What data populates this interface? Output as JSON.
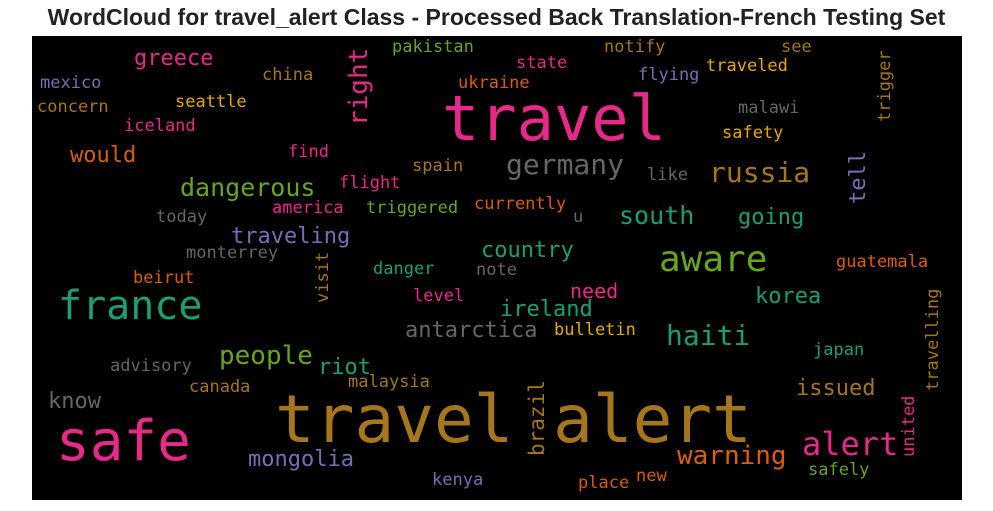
{
  "title": "WordCloud for travel_alert Class - Processed Back Translation-French Testing Set",
  "colors": {
    "pink": "#e7298a",
    "green": "#66a61e",
    "teal": "#1b9e77",
    "orange": "#d95f02",
    "purple": "#7570b3",
    "gold": "#e6ab02",
    "brown": "#a6761d",
    "gray": "#666666"
  },
  "words": [
    {
      "text": "travel alert",
      "color": "brown"
    },
    {
      "text": "travel",
      "color": "pink"
    },
    {
      "text": "safe",
      "color": "pink"
    },
    {
      "text": "france",
      "color": "teal"
    },
    {
      "text": "aware",
      "color": "green"
    },
    {
      "text": "alert",
      "color": "pink"
    },
    {
      "text": "germany",
      "color": "gray"
    },
    {
      "text": "russia",
      "color": "brown"
    },
    {
      "text": "haiti",
      "color": "teal"
    },
    {
      "text": "dangerous",
      "color": "green"
    },
    {
      "text": "warning",
      "color": "orange"
    },
    {
      "text": "people",
      "color": "green"
    },
    {
      "text": "south",
      "color": "teal"
    },
    {
      "text": "right",
      "color": "pink"
    },
    {
      "text": "mongolia",
      "color": "purple"
    },
    {
      "text": "antarctica",
      "color": "gray"
    },
    {
      "text": "traveling",
      "color": "purple"
    },
    {
      "text": "going",
      "color": "teal"
    },
    {
      "text": "ireland",
      "color": "teal"
    },
    {
      "text": "country",
      "color": "teal"
    },
    {
      "text": "korea",
      "color": "teal"
    },
    {
      "text": "issued",
      "color": "brown"
    },
    {
      "text": "greece",
      "color": "pink"
    },
    {
      "text": "would",
      "color": "orange"
    },
    {
      "text": "need",
      "color": "pink"
    },
    {
      "text": "brazil",
      "color": "brown"
    },
    {
      "text": "riot",
      "color": "teal"
    },
    {
      "text": "tell",
      "color": "purple"
    },
    {
      "text": "know",
      "color": "gray"
    },
    {
      "text": "flight",
      "color": "pink"
    },
    {
      "text": "mexico",
      "color": "purple"
    },
    {
      "text": "concern",
      "color": "brown"
    },
    {
      "text": "china",
      "color": "brown"
    },
    {
      "text": "pakistan",
      "color": "green"
    },
    {
      "text": "state",
      "color": "pink"
    },
    {
      "text": "ukraine",
      "color": "orange"
    },
    {
      "text": "notify",
      "color": "brown"
    },
    {
      "text": "flying",
      "color": "purple"
    },
    {
      "text": "see",
      "color": "brown"
    },
    {
      "text": "traveled",
      "color": "gold"
    },
    {
      "text": "trigger",
      "color": "brown"
    },
    {
      "text": "seattle",
      "color": "gold"
    },
    {
      "text": "iceland",
      "color": "pink"
    },
    {
      "text": "malawi",
      "color": "gray"
    },
    {
      "text": "safety",
      "color": "gold"
    },
    {
      "text": "find",
      "color": "pink"
    },
    {
      "text": "spain",
      "color": "brown"
    },
    {
      "text": "like",
      "color": "gray"
    },
    {
      "text": "today",
      "color": "gray"
    },
    {
      "text": "america",
      "color": "pink"
    },
    {
      "text": "triggered",
      "color": "green"
    },
    {
      "text": "currently",
      "color": "orange"
    },
    {
      "text": "u",
      "color": "gray"
    },
    {
      "text": "monterrey",
      "color": "gray"
    },
    {
      "text": "beirut",
      "color": "orange"
    },
    {
      "text": "visit",
      "color": "brown"
    },
    {
      "text": "danger",
      "color": "teal"
    },
    {
      "text": "note",
      "color": "gray"
    },
    {
      "text": "guatemala",
      "color": "orange"
    },
    {
      "text": "level",
      "color": "pink"
    },
    {
      "text": "bulletin",
      "color": "gold"
    },
    {
      "text": "travelling",
      "color": "brown"
    },
    {
      "text": "advisory",
      "color": "gray"
    },
    {
      "text": "japan",
      "color": "teal"
    },
    {
      "text": "canada",
      "color": "brown"
    },
    {
      "text": "malaysia",
      "color": "brown"
    },
    {
      "text": "united",
      "color": "pink"
    },
    {
      "text": "safely",
      "color": "green"
    },
    {
      "text": "kenya",
      "color": "purple"
    },
    {
      "text": "place",
      "color": "orange"
    },
    {
      "text": "new",
      "color": "orange"
    }
  ]
}
